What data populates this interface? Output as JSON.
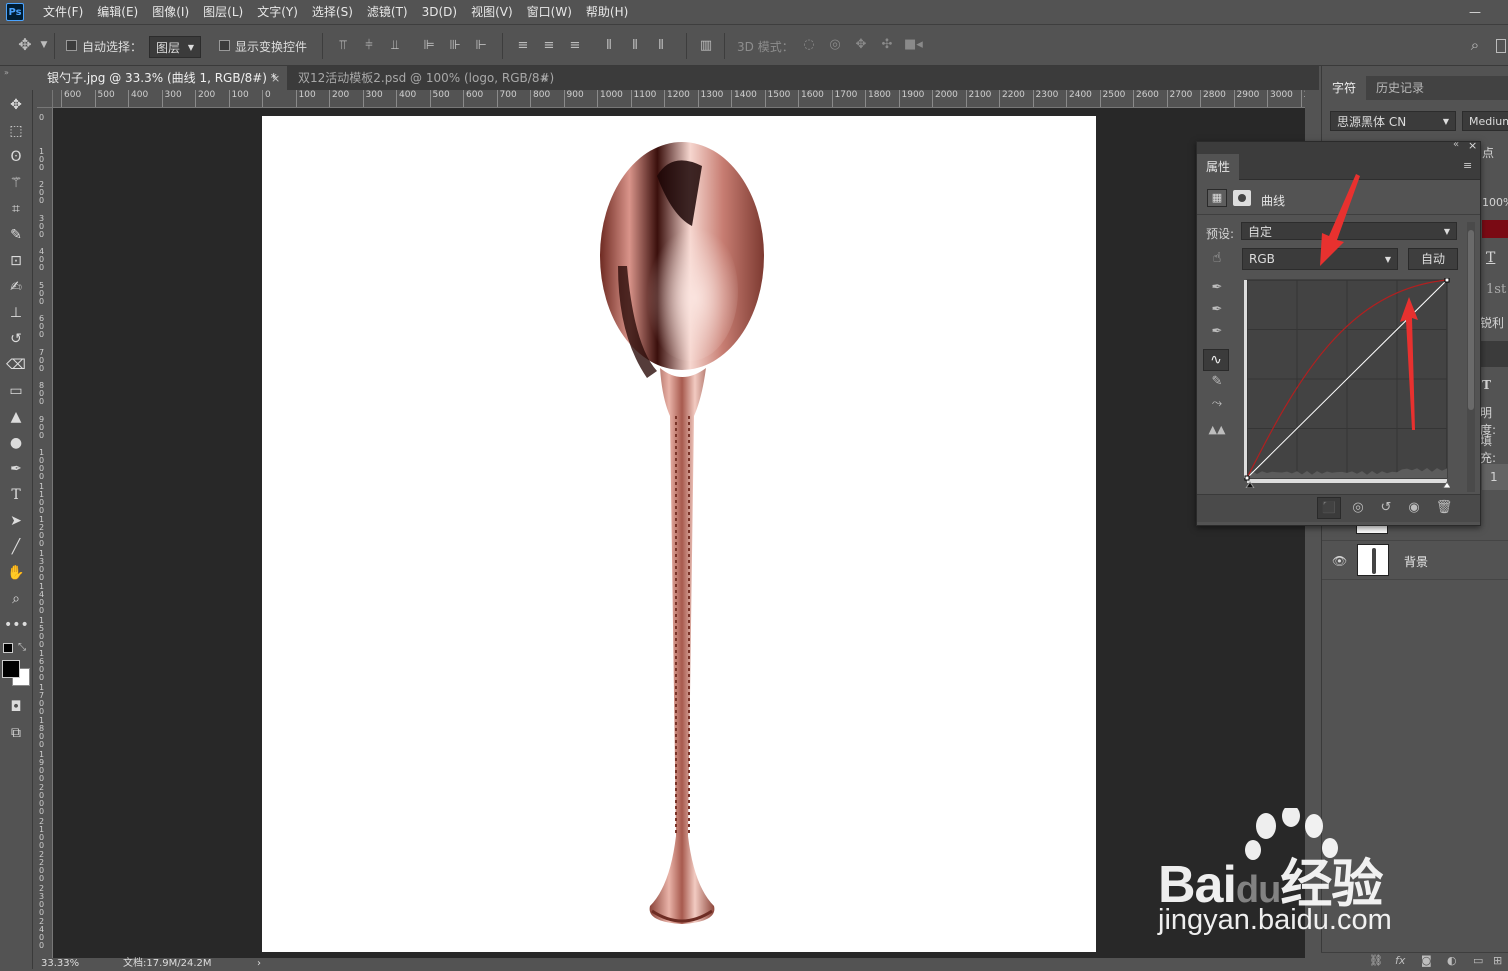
{
  "app": {
    "logo": "Ps"
  },
  "menu": [
    "文件(F)",
    "编辑(E)",
    "图像(I)",
    "图层(L)",
    "文字(Y)",
    "选择(S)",
    "滤镜(T)",
    "3D(D)",
    "视图(V)",
    "窗口(W)",
    "帮助(H)"
  ],
  "window": {
    "minimize": "—"
  },
  "options": {
    "auto_select_label": "自动选择：",
    "auto_select_target": "图层",
    "show_transform_label": "显示变换控件",
    "mode_3d_label": "3D 模式："
  },
  "tabs": [
    {
      "label": "银勺子.jpg @ 33.3% (曲线 1, RGB/8#) *",
      "active": true
    },
    {
      "label": "双12活动模板2.psd @ 100% (logo, RGB/8#)",
      "active": false
    }
  ],
  "ruler": {
    "h": [
      "600",
      "500",
      "400",
      "300",
      "200",
      "100",
      "0",
      "100",
      "200",
      "300",
      "400",
      "500",
      "600",
      "700",
      "800",
      "900",
      "1000",
      "1100",
      "1200",
      "1300",
      "1400",
      "1500",
      "1600",
      "1700",
      "1800",
      "1900",
      "2000",
      "2100",
      "2200",
      "2300",
      "2400",
      "2500",
      "2600",
      "2700",
      "2800",
      "2900",
      "3000",
      "3"
    ],
    "v": [
      "0",
      "1 0 0",
      "2 0 0",
      "3 0 0",
      "4 0 0",
      "5 0 0",
      "6 0 0",
      "7 0 0",
      "8 0 0",
      "9 0 0",
      "1 0 0 0",
      "1 1 0 0",
      "1 2 0 0",
      "1 3 0 0",
      "1 4 0 0",
      "1 5 0 0",
      "1 6 0 0",
      "1 7 0 0",
      "1 8 0 0",
      "1 9 0 0",
      "2 0 0 0",
      "2 1 0 0",
      "2 2 0 0",
      "2 3 0 0",
      "2 4 0 0"
    ]
  },
  "status": {
    "zoom": "33.33%",
    "doc": "文档:17.9M/24.2M"
  },
  "right_panel": {
    "tabs": [
      "字符",
      "历史记录"
    ],
    "font_family": "思源黑体 CN",
    "font_style": "Medium",
    "size_fragment": "点",
    "pct": "100%",
    "superscript": "1st",
    "aa_fragment": "锐利",
    "opacity_fragment": "明度:",
    "fill_fragment": "填充:",
    "layer_num": "1",
    "layers": [
      {
        "name": "背景"
      }
    ],
    "swatch_color": "#7a0a14"
  },
  "properties": {
    "title": "属性",
    "type_label": "曲线",
    "preset_label": "预设:",
    "preset_value": "自定",
    "channel": "RGB",
    "auto_button": "自动"
  },
  "curve": {
    "input_range": [
      0,
      255
    ],
    "points": [
      [
        0,
        0
      ],
      [
        255,
        255
      ]
    ],
    "curve_color": "#b02020",
    "baseline_color": "#ffffff"
  },
  "annotations": {
    "arrow_color": "#e8312f"
  },
  "watermark": {
    "brand_a": "Bai",
    "brand_b": "du",
    "brand_c": "经验",
    "url": "jingyan.baidu.com"
  }
}
